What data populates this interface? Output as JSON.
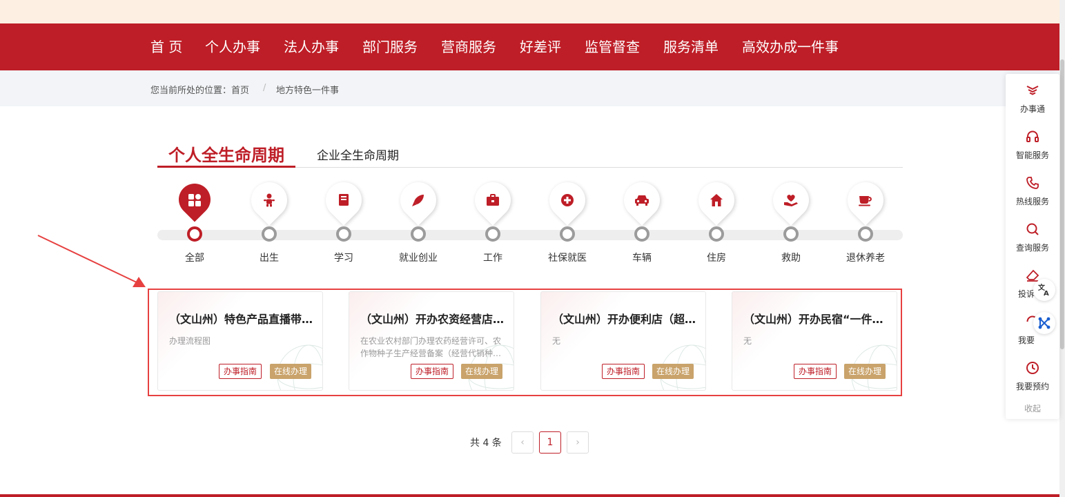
{
  "nav": {
    "items": [
      "首 页",
      "个人办事",
      "法人办事",
      "部门服务",
      "营商服务",
      "好差评",
      "监管督查",
      "服务清单",
      "高效办成一件事"
    ]
  },
  "breadcrumb": {
    "prefix": "您当前所处的位置：首页",
    "separator": "/",
    "current": "地方特色一件事"
  },
  "tabs": {
    "active": "个人全生命周期",
    "other": "企业全生命周期"
  },
  "stages": [
    {
      "label": "全部",
      "icon": "grid-icon"
    },
    {
      "label": "出生",
      "icon": "baby-icon"
    },
    {
      "label": "学习",
      "icon": "book-icon"
    },
    {
      "label": "就业创业",
      "icon": "rocket-icon"
    },
    {
      "label": "工作",
      "icon": "briefcase-icon"
    },
    {
      "label": "社保就医",
      "icon": "medical-cross-icon"
    },
    {
      "label": "车辆",
      "icon": "car-icon"
    },
    {
      "label": "住房",
      "icon": "house-icon"
    },
    {
      "label": "救助",
      "icon": "heart-hand-icon"
    },
    {
      "label": "退休养老",
      "icon": "teacup-icon"
    }
  ],
  "cards": [
    {
      "title": "（文山州）特色产品直播带…",
      "desc": "办理流程图",
      "guide": "办事指南",
      "online": "在线办理"
    },
    {
      "title": "（文山州）开办农资经营店…",
      "desc": "在农业农村部门办理农药经营许可、农作物种子生产经营备案（经营代销种…",
      "guide": "办事指南",
      "online": "在线办理"
    },
    {
      "title": "（文山州）开办便利店（超…",
      "desc": "无",
      "guide": "办事指南",
      "online": "在线办理"
    },
    {
      "title": "（文山州）开办民宿“一件…",
      "desc": "无",
      "guide": "办事指南",
      "online": "在线办理"
    }
  ],
  "pager": {
    "total": "共 4 条",
    "prev": "‹",
    "current": "1",
    "next": "›"
  },
  "side_panel": {
    "items": [
      {
        "label": "办事通",
        "icon": "banshitong-logo-icon"
      },
      {
        "label": "智能服务",
        "icon": "headset-icon"
      },
      {
        "label": "热线服务",
        "icon": "phone-icon"
      },
      {
        "label": "查询服务",
        "icon": "search-icon"
      },
      {
        "label": "投诉",
        "icon": "eraser-icon"
      },
      {
        "label": "我要",
        "icon": "refresh-icon"
      },
      {
        "label": "我要预约",
        "icon": "clock-icon"
      }
    ],
    "collapse": "收起"
  },
  "colors": {
    "brand_red": "#be1e27",
    "gold": "#c9a36b",
    "annotation_red": "#e74040"
  }
}
